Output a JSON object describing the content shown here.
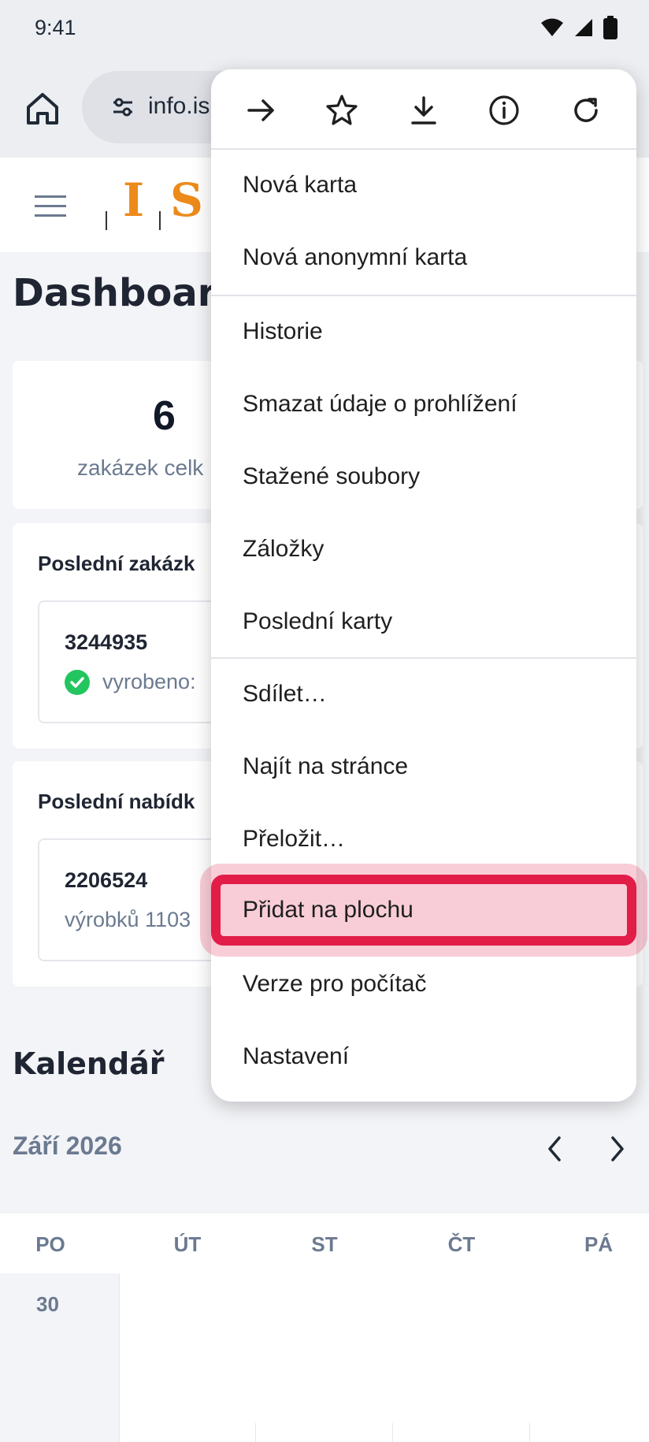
{
  "status_bar": {
    "time": "9:41"
  },
  "browser": {
    "url": "info.is"
  },
  "logo": {
    "letter1": "I",
    "letter2": "S"
  },
  "page": {
    "title": "Dashboard",
    "stat": {
      "number": "6",
      "label": "zakázek celk"
    },
    "orders_section": {
      "title": "Poslední zakázk",
      "item_id": "3244935",
      "item_status": "vyrobeno:"
    },
    "offers_section": {
      "title": "Poslední nabídk",
      "item_id": "2206524",
      "item_detail": "výrobků 1103"
    },
    "calendar": {
      "title": "Kalendář",
      "month": "Září 2026",
      "weekdays": [
        "PO",
        "ÚT",
        "ST",
        "ČT",
        "PÁ"
      ],
      "first_day": "30"
    }
  },
  "menu": {
    "toolbar_icons": [
      "forward-icon",
      "star-icon",
      "download-icon",
      "info-icon",
      "reload-icon"
    ],
    "items": [
      "Nová karta",
      "Nová anonymní karta",
      "Historie",
      "Smazat údaje o prohlížení",
      "Stažené soubory",
      "Záložky",
      "Poslední karty",
      "Sdílet…",
      "Najít na stránce",
      "Přeložit…",
      "Přidat na plochu",
      "Verze pro počítač",
      "Nastavení"
    ],
    "highlighted_item": "Přidat na plochu",
    "highlight_color": "#e11d48"
  }
}
